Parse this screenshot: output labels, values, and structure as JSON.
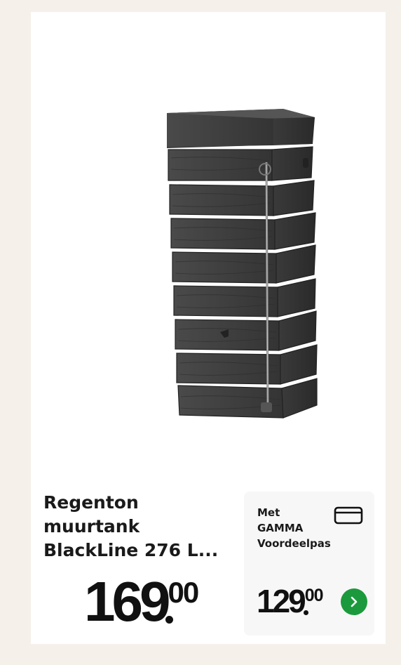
{
  "product": {
    "title_lines": [
      "Regenton",
      "muurtank",
      "BlackLine 276 L..."
    ],
    "image_icon": "rain-barrel-image",
    "price": {
      "integer": "169",
      "cents": "00"
    }
  },
  "promo": {
    "label_lines": [
      "Met",
      "GAMMA",
      "Voordeelpas"
    ],
    "icon": "card-icon",
    "price": {
      "integer": "129",
      "cents": "00"
    },
    "action_icon": "chevron-right-icon"
  },
  "colors": {
    "background": "#f5f0e9",
    "card": "#ffffff",
    "promo_panel": "#f7f7f7",
    "accent_green": "#1a9a3c",
    "text": "#111111"
  }
}
